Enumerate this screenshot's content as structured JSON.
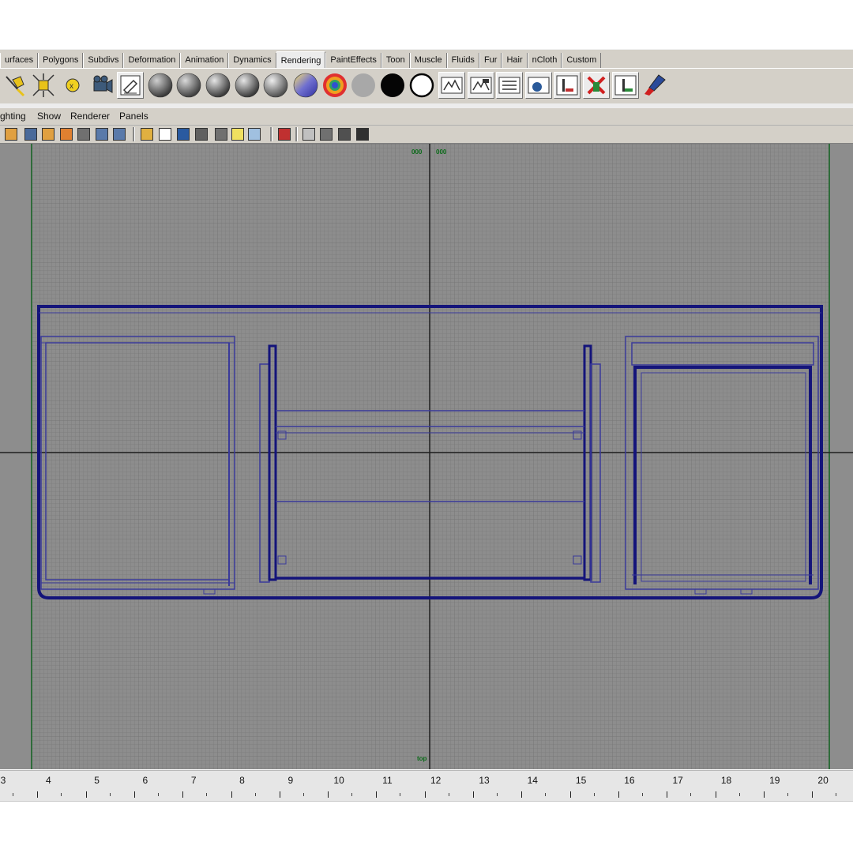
{
  "shelf_tabs": [
    {
      "label": "urfaces"
    },
    {
      "label": "Polygons"
    },
    {
      "label": "Subdivs"
    },
    {
      "label": "Deformation"
    },
    {
      "label": "Animation"
    },
    {
      "label": "Dynamics"
    },
    {
      "label": "Rendering",
      "active": true
    },
    {
      "label": "PaintEffects"
    },
    {
      "label": "Toon"
    },
    {
      "label": "Muscle"
    },
    {
      "label": "Fluids"
    },
    {
      "label": "Fur"
    },
    {
      "label": "Hair"
    },
    {
      "label": "nCloth"
    },
    {
      "label": "Custom"
    }
  ],
  "shelf_icons": [
    "spot-light-icon",
    "area-light-icon",
    "point-light-icon",
    "camera-icon",
    "hypershade-icon",
    "lambert-shader-icon",
    "blinn-shader-icon",
    "phong-shader-icon",
    "phong-e-shader-icon",
    "anisotropic-shader-icon",
    "ramp-shader-icon",
    "layered-shader-icon",
    "surface-shader-icon",
    "use-background-shader-icon",
    "outline-shader-icon",
    "render-current-frame-icon",
    "ipr-render-icon",
    "render-settings-icon",
    "batch-render-icon",
    "render-view-icon",
    "cancel-render-icon",
    "create-render-node-icon",
    "paint-canvas-icon"
  ],
  "panel_menu": [
    "ghting",
    "Show",
    "Renderer",
    "Panels"
  ],
  "panel_toolbar_icons": [
    "select-camera-icon",
    "camera-attributes-icon",
    "bookmark-icon",
    "image-plane-icon",
    "grid-toggle-icon",
    "film-gate-icon",
    "resolution-gate-icon",
    "frame-all-icon",
    "wireframe-icon",
    "smooth-shade-icon",
    "flat-shade-icon",
    "textured-icon",
    "use-all-lights-icon",
    "shadows-icon",
    "xray-icon",
    "isolate-select-icon",
    "hud-icon",
    "high-quality-icon",
    "show-menu-icon"
  ],
  "viewport": {
    "camera_label": "top",
    "gate_label_left": "000",
    "gate_label_right": "000",
    "colors": {
      "background": "#8a8a8a",
      "grid": "#7a7a7a",
      "axis": "#1f1f1f",
      "gate": "#2f6b3a",
      "wireframe": "#14147a",
      "wireframe_thin": "#3a3a9a"
    }
  },
  "ruler": {
    "labels": [
      "3",
      "4",
      "5",
      "6",
      "7",
      "8",
      "9",
      "10",
      "11",
      "12",
      "13",
      "14",
      "15",
      "16",
      "17",
      "18",
      "19",
      "20"
    ]
  }
}
